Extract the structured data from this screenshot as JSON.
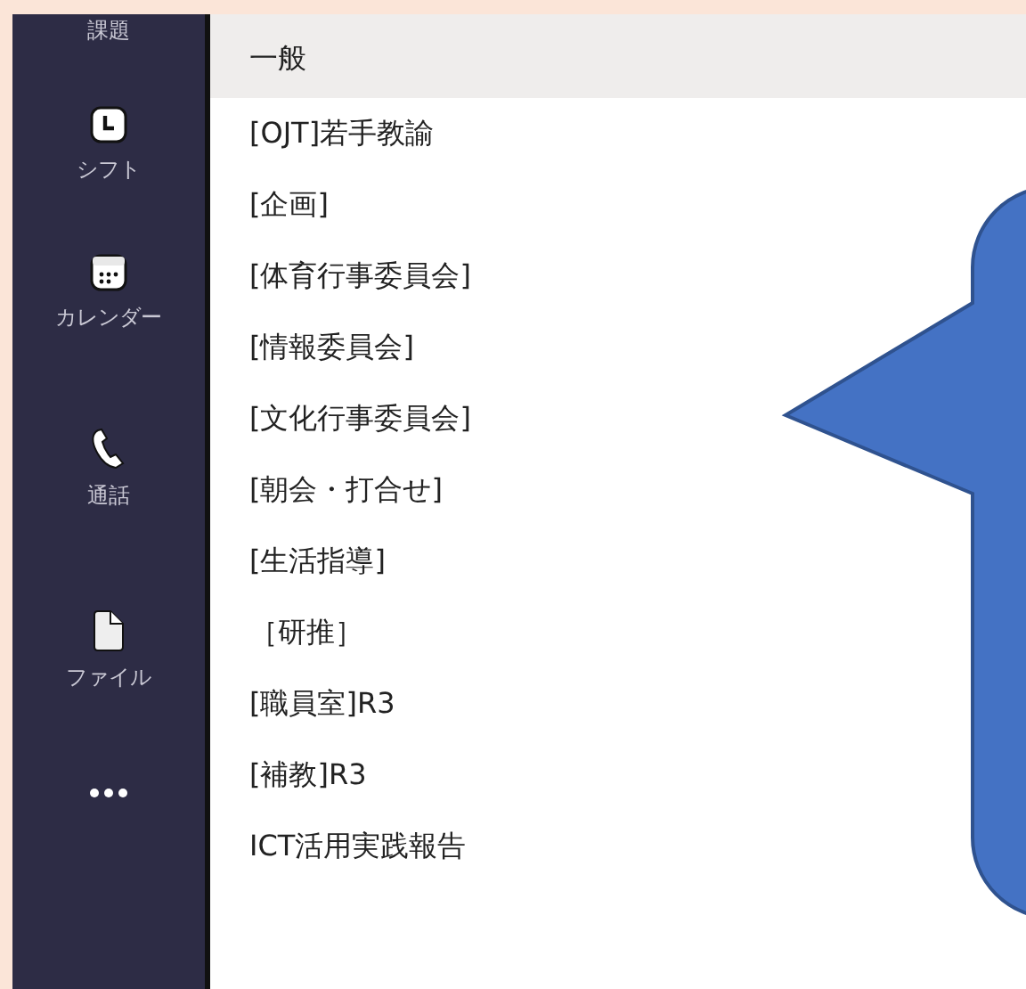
{
  "sidebar": {
    "items": [
      {
        "kind": "tasks",
        "label": "課題"
      },
      {
        "kind": "shifts",
        "label": "シフト"
      },
      {
        "kind": "calendar",
        "label": "カレンダー"
      },
      {
        "kind": "calls",
        "label": "通話"
      },
      {
        "kind": "files",
        "label": "ファイル"
      },
      {
        "kind": "more"
      }
    ]
  },
  "channels": [
    {
      "name": "一般",
      "selected": true
    },
    {
      "name": "[OJT]若手教諭",
      "selected": false
    },
    {
      "name": "[企画]",
      "selected": false
    },
    {
      "name": "[体育行事委員会]",
      "selected": false
    },
    {
      "name": "[情報委員会]",
      "selected": false
    },
    {
      "name": "[文化行事委員会]",
      "selected": false
    },
    {
      "name": "[朝会・打合せ]",
      "selected": false
    },
    {
      "name": "[生活指導]",
      "selected": false
    },
    {
      "name": "［研推］",
      "selected": false
    },
    {
      "name": "[職員室]R3",
      "selected": false
    },
    {
      "name": "[補教]R3",
      "selected": false
    },
    {
      "name": "ICT活用実践報告",
      "selected": false
    }
  ]
}
